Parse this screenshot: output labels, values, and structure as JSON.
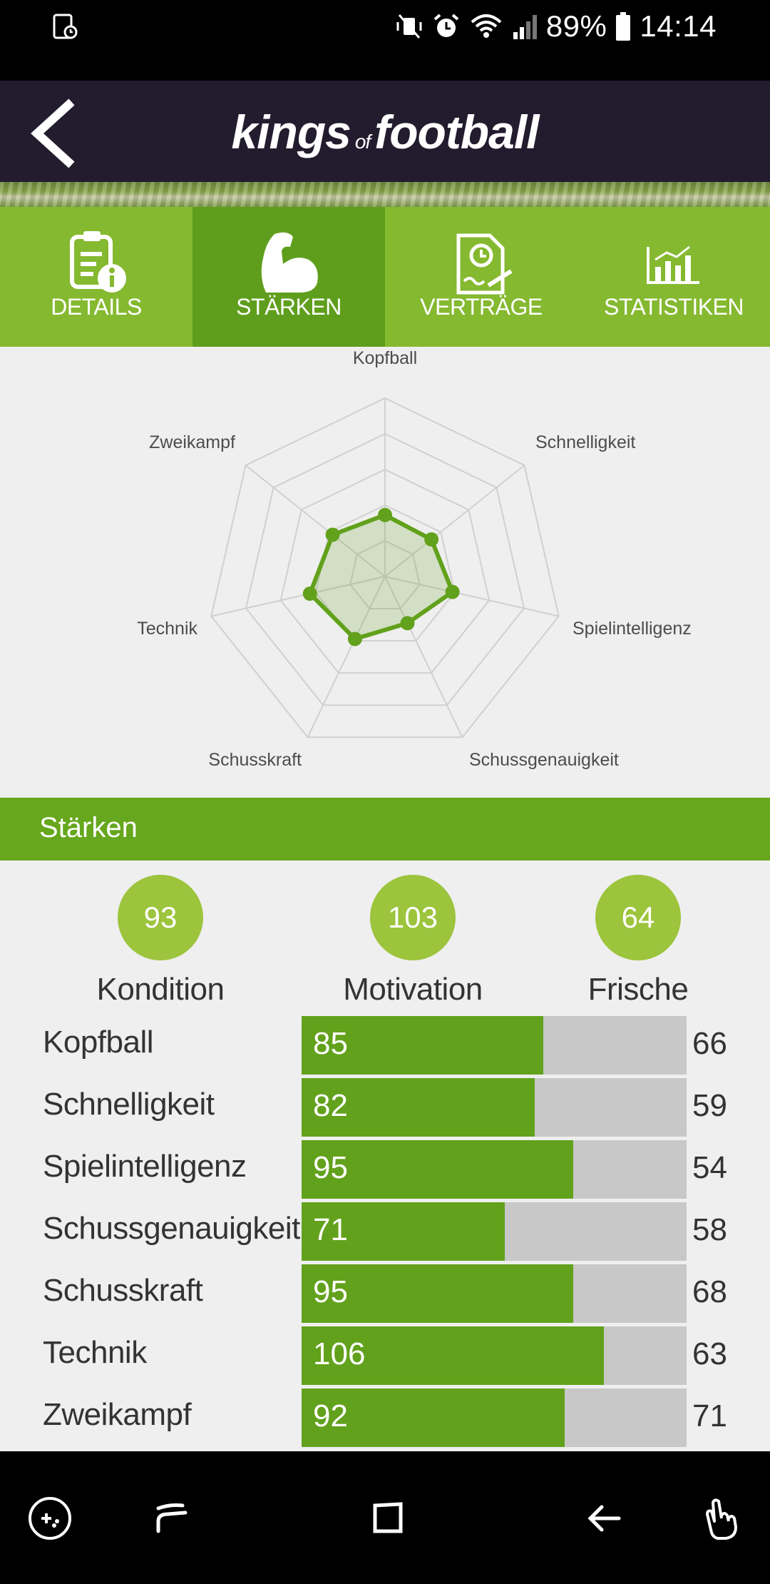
{
  "status_bar": {
    "battery": "89%",
    "time": "14:14"
  },
  "app": {
    "logo_left": "kings",
    "logo_of": "of",
    "logo_right": "football"
  },
  "tabs": [
    {
      "label": "DETAILS",
      "icon": "clipboard-info-icon",
      "active": false
    },
    {
      "label": "STÄRKEN",
      "icon": "flexed-arm-icon",
      "active": true
    },
    {
      "label": "VERTRÄGE",
      "icon": "contract-icon",
      "active": false
    },
    {
      "label": "STATISTIKEN",
      "icon": "bar-chart-icon",
      "active": false
    }
  ],
  "radar": {
    "labels": [
      "Kopfball",
      "Schnelligkeit",
      "Spielintelligenz",
      "Schussgenauigkeit",
      "Schusskraft",
      "Technik",
      "Zweikampf"
    ]
  },
  "section_title": "Stärken",
  "stats": [
    {
      "value": "93",
      "label": "Kondition"
    },
    {
      "value": "103",
      "label": "Motivation"
    },
    {
      "value": "64",
      "label": "Frische"
    }
  ],
  "attributes": [
    {
      "name": "Kopfball",
      "value": "85",
      "right": "66",
      "fill": 0.627
    },
    {
      "name": "Schnelligkeit",
      "value": "82",
      "right": "59",
      "fill": 0.606
    },
    {
      "name": "Spielintelligenz",
      "value": "95",
      "right": "54",
      "fill": 0.706
    },
    {
      "name": "Schussgenauigkeit",
      "value": "71",
      "right": "58",
      "fill": 0.528
    },
    {
      "name": "Schusskraft",
      "value": "95",
      "right": "68",
      "fill": 0.706
    },
    {
      "name": "Technik",
      "value": "106",
      "right": "63",
      "fill": 0.785
    },
    {
      "name": "Zweikampf",
      "value": "92",
      "right": "71",
      "fill": 0.683
    }
  ],
  "colors": {
    "green_dark": "#62a11c",
    "green_tab": "#85b930",
    "green_active": "#5f9e1c",
    "circle": "#9cc43c",
    "header": "#221c2e"
  }
}
